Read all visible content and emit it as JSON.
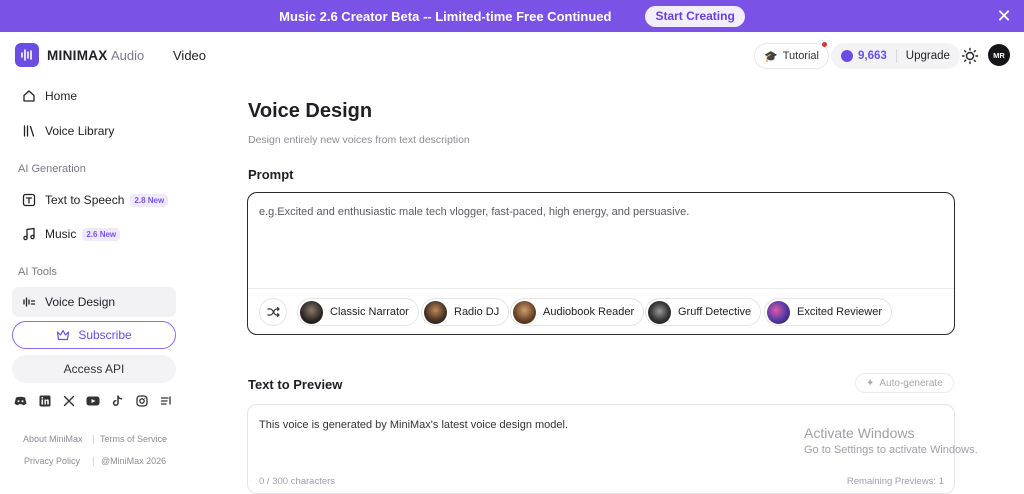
{
  "banner": {
    "text": "Music 2.6 Creator Beta -- Limited-time Free Continued",
    "cta": "Start Creating",
    "close_icon": "close-icon"
  },
  "header": {
    "logo": "MINIMAX",
    "product_audio": "Audio",
    "nav_video": "Video",
    "tutorial": "Tutorial",
    "credits": "9,663",
    "upgrade": "Upgrade",
    "avatar_initials": "MR"
  },
  "sidebar": {
    "items": [
      {
        "label": "Home",
        "icon": "home-icon"
      },
      {
        "label": "Voice Library",
        "icon": "library-icon"
      }
    ],
    "section_ai_generation": "AI Generation",
    "generation_items": [
      {
        "label": "Text to Speech",
        "badge": "2.8 New",
        "icon": "tts-icon"
      },
      {
        "label": "Music",
        "badge": "2.6 New",
        "icon": "music-icon"
      }
    ],
    "section_ai_tools": "AI Tools",
    "tool_items": [
      {
        "label": "Voice Design",
        "icon": "waveform-icon"
      }
    ],
    "subscribe": "Subscribe",
    "access_api": "Access API",
    "footer": {
      "about": "About MiniMax",
      "terms": "Terms of Service",
      "privacy": "Privacy Policy",
      "copyright": "@MiniMax 2026"
    }
  },
  "main": {
    "title": "Voice Design",
    "subtitle": "Design entirely new voices from text description",
    "prompt_label": "Prompt",
    "prompt_placeholder": "e.g.Excited and enthusiastic male tech vlogger, fast-paced, high energy, and persuasive.",
    "presets": [
      {
        "label": "Classic Narrator"
      },
      {
        "label": "Radio DJ"
      },
      {
        "label": "Audiobook Reader"
      },
      {
        "label": "Gruff Detective"
      },
      {
        "label": "Excited Reviewer"
      }
    ],
    "preview_label": "Text to Preview",
    "auto_generate": "Auto-generate",
    "preview_text": "This voice is generated by MiniMax's latest voice design model.",
    "char_count": "0 / 300 characters",
    "remaining": "Remaining Previews: 1"
  },
  "watermark": {
    "title": "Activate Windows",
    "subtitle": "Go to Settings to activate Windows."
  },
  "colors": {
    "accent": "#7b52e6",
    "brand": "#6b4de6"
  }
}
